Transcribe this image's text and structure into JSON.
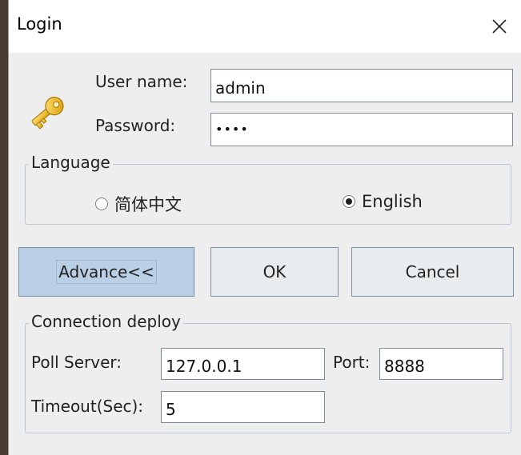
{
  "window": {
    "title": "Login",
    "close_icon": "close-icon"
  },
  "login": {
    "username_label": "User name:",
    "username_value": "admin",
    "password_label": "Password:",
    "password_value": "••••",
    "icon": "key-icon"
  },
  "language": {
    "legend": "Language",
    "options": [
      {
        "label": "简体中文",
        "selected": false
      },
      {
        "label": "English",
        "selected": true
      }
    ]
  },
  "buttons": {
    "advance": "Advance<<",
    "ok": "OK",
    "cancel": "Cancel"
  },
  "connection": {
    "legend": "Connection deploy",
    "poll_server_label": "Poll Server:",
    "poll_server_value": "127.0.0.1",
    "port_label": "Port:",
    "port_value": "8888",
    "timeout_label": "Timeout(Sec):",
    "timeout_value": "5"
  },
  "colors": {
    "accent_button": "#b8cfe5",
    "group_border": "#b7c6d6",
    "key_gold": "#f2b600"
  }
}
